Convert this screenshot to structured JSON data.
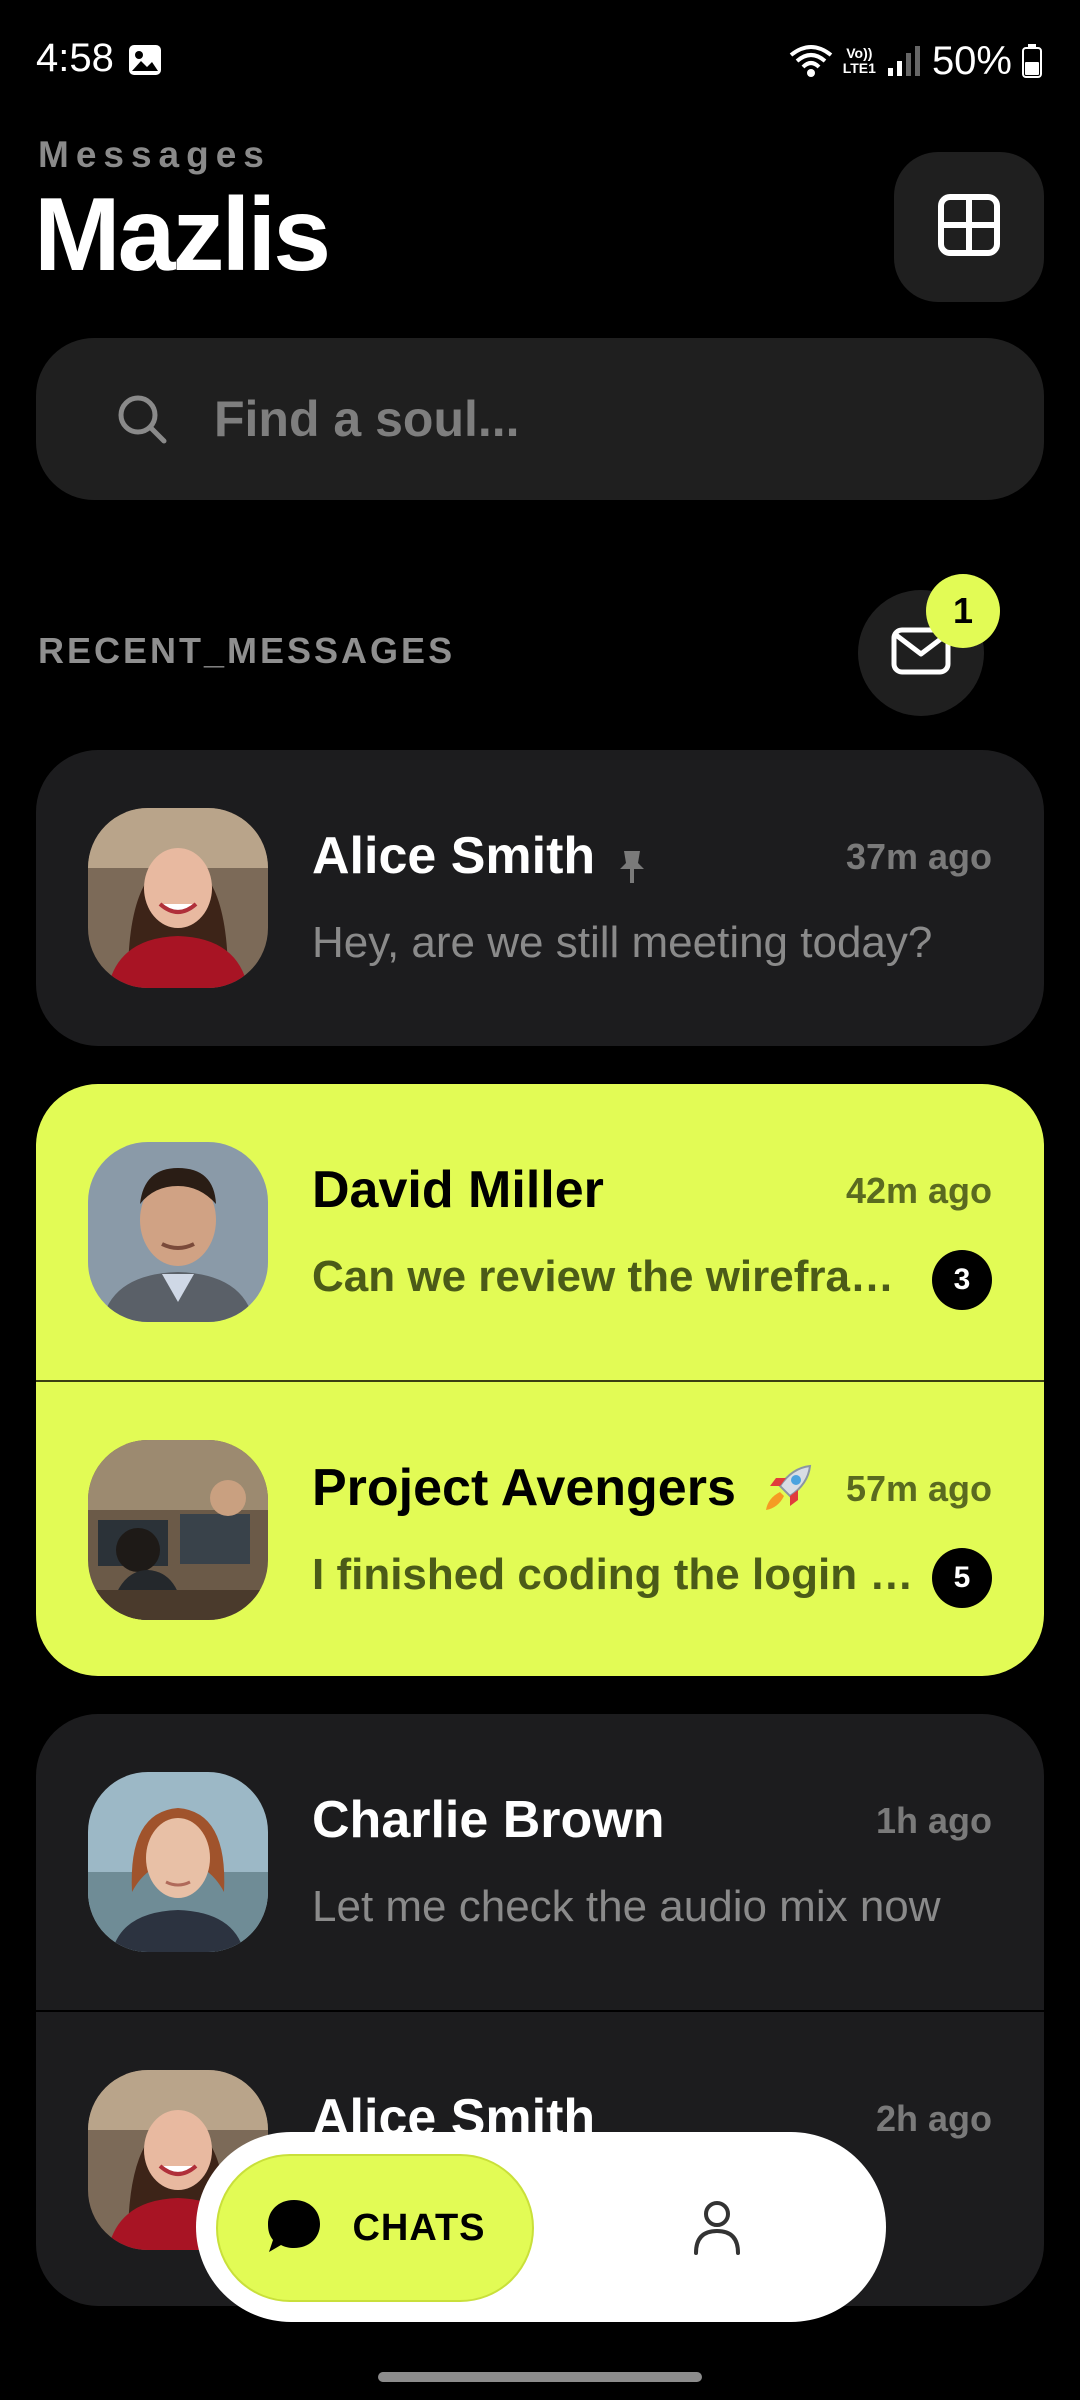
{
  "status_bar": {
    "time": "4:58",
    "network_label_top": "Vo))",
    "network_label_bottom": "LTE1",
    "battery": "50%"
  },
  "header": {
    "subtitle": "Messages",
    "title": "Mazlis",
    "grid_icon": "grid-icon"
  },
  "search": {
    "placeholder": "Find a soul...",
    "value": ""
  },
  "section": {
    "label": "RECENT_MESSAGES",
    "mail_badge_count": "1"
  },
  "chats": [
    {
      "name": "Alice Smith",
      "time": "37m ago",
      "preview": "Hey, are we still meeting today?",
      "pinned": true,
      "unread": ""
    },
    {
      "name": "David Miller",
      "time": "42m ago",
      "preview": "Can we review the wireframes today?",
      "unread": "3"
    },
    {
      "name": "Project Avengers",
      "time": "57m ago",
      "preview": "I finished coding the login screen",
      "emoji_icon": "rocket-icon",
      "unread": "5"
    },
    {
      "name": "Charlie Brown",
      "time": "1h ago",
      "preview": "Let me check the audio mix now",
      "unread": ""
    },
    {
      "name": "Alice Smith",
      "time": "2h ago",
      "preview": "",
      "unread": ""
    }
  ],
  "bottom_nav": {
    "chats_label": "CHATS",
    "profile_icon": "person-icon"
  },
  "colors": {
    "accent": "#e2fb55",
    "background": "#000000",
    "card": "#1c1c1e"
  }
}
